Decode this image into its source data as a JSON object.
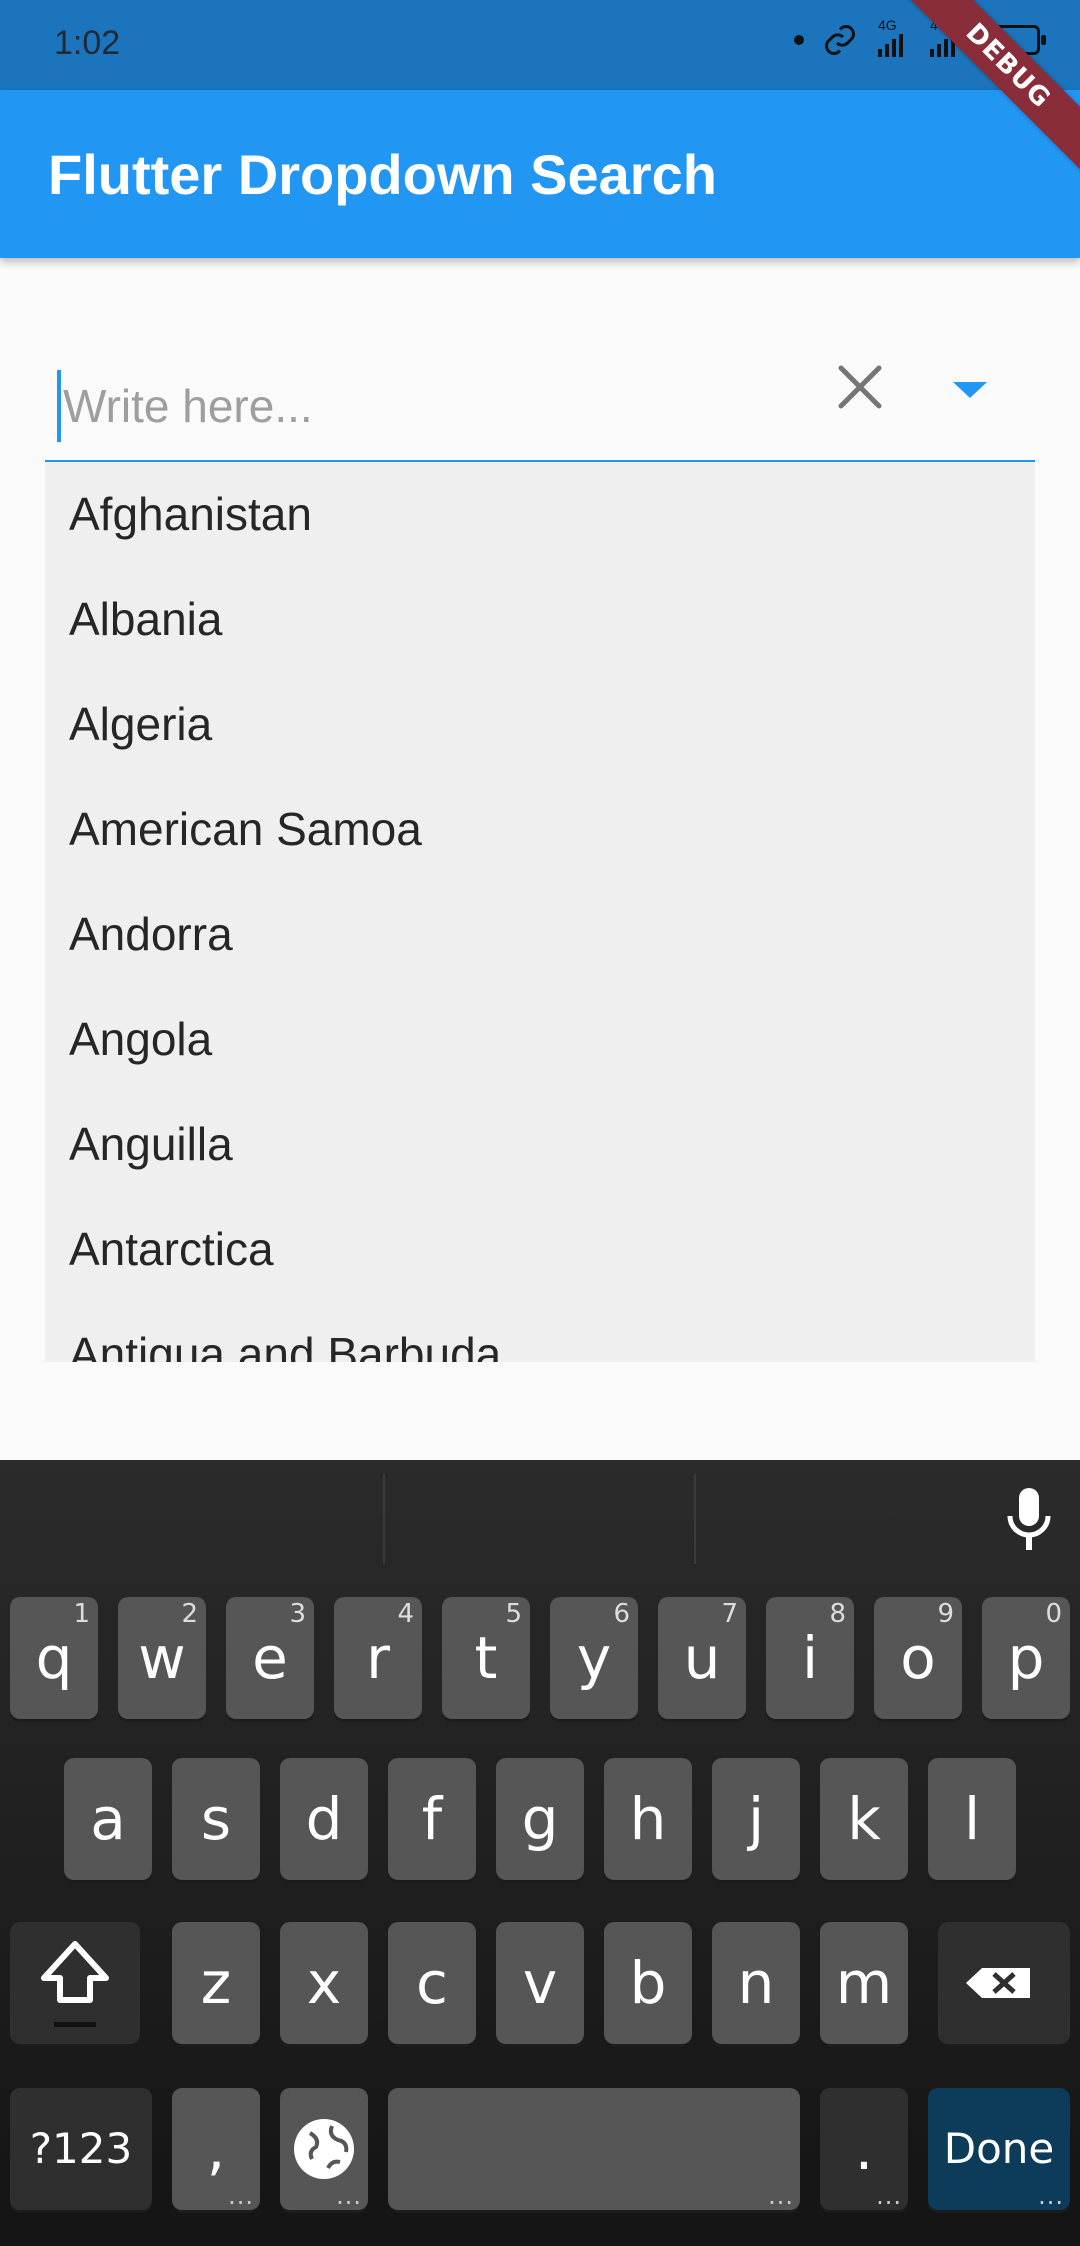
{
  "status_bar": {
    "time": "1:02",
    "signal_label_1": "4G",
    "signal_label_2": "4G"
  },
  "debug_banner": "DEBUG",
  "app_bar": {
    "title": "Flutter Dropdown Search"
  },
  "search": {
    "placeholder": "Write here...",
    "value": ""
  },
  "options": [
    "Afghanistan",
    "Albania",
    "Algeria",
    "American Samoa",
    "Andorra",
    "Angola",
    "Anguilla",
    "Antarctica",
    "Antigua and Barbuda"
  ],
  "keyboard": {
    "row1": [
      {
        "k": "q",
        "n": "1"
      },
      {
        "k": "w",
        "n": "2"
      },
      {
        "k": "e",
        "n": "3"
      },
      {
        "k": "r",
        "n": "4"
      },
      {
        "k": "t",
        "n": "5"
      },
      {
        "k": "y",
        "n": "6"
      },
      {
        "k": "u",
        "n": "7"
      },
      {
        "k": "i",
        "n": "8"
      },
      {
        "k": "o",
        "n": "9"
      },
      {
        "k": "p",
        "n": "0"
      }
    ],
    "row2": [
      "a",
      "s",
      "d",
      "f",
      "g",
      "h",
      "j",
      "k",
      "l"
    ],
    "row3": [
      "z",
      "x",
      "c",
      "v",
      "b",
      "n",
      "m"
    ],
    "symbols_label": "?123",
    "comma_label": ",",
    "period_label": ".",
    "done_label": "Done",
    "accent_color": "#2196f3"
  }
}
